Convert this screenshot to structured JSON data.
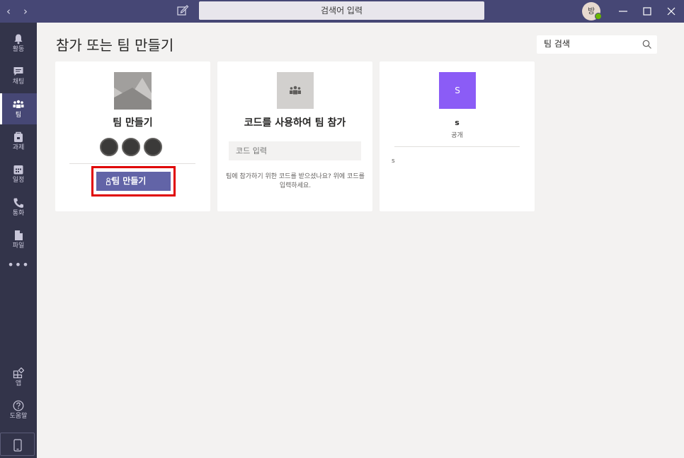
{
  "titlebar": {
    "search_placeholder": "검색어 입력",
    "avatar_initial": "방",
    "accent": "#464775"
  },
  "rail": {
    "items": [
      {
        "label": "활동",
        "icon": "bell-icon"
      },
      {
        "label": "채팅",
        "icon": "chat-icon"
      },
      {
        "label": "팀",
        "icon": "teams-icon",
        "active": true
      },
      {
        "label": "과제",
        "icon": "assignments-icon"
      },
      {
        "label": "일정",
        "icon": "calendar-icon"
      },
      {
        "label": "통화",
        "icon": "phone-icon"
      },
      {
        "label": "파일",
        "icon": "file-icon"
      }
    ],
    "more": "•••",
    "apps_label": "앱",
    "help_label": "도움말"
  },
  "main": {
    "title": "참가 또는 팀 만들기",
    "team_search_placeholder": "팀 검색"
  },
  "cards": {
    "create": {
      "title": "팀 만들기",
      "button_label": "팀 만들기"
    },
    "join": {
      "title": "코드를 사용하여 팀 참가",
      "input_placeholder": "코드 입력",
      "help_text": "팀에 참가하기 위한 코드를 받으셨나요? 위에 코드를 입력하세요."
    },
    "team": {
      "initial": "S",
      "name": "s",
      "type": "공개",
      "description": "s",
      "color": "#8b5cf6"
    }
  }
}
